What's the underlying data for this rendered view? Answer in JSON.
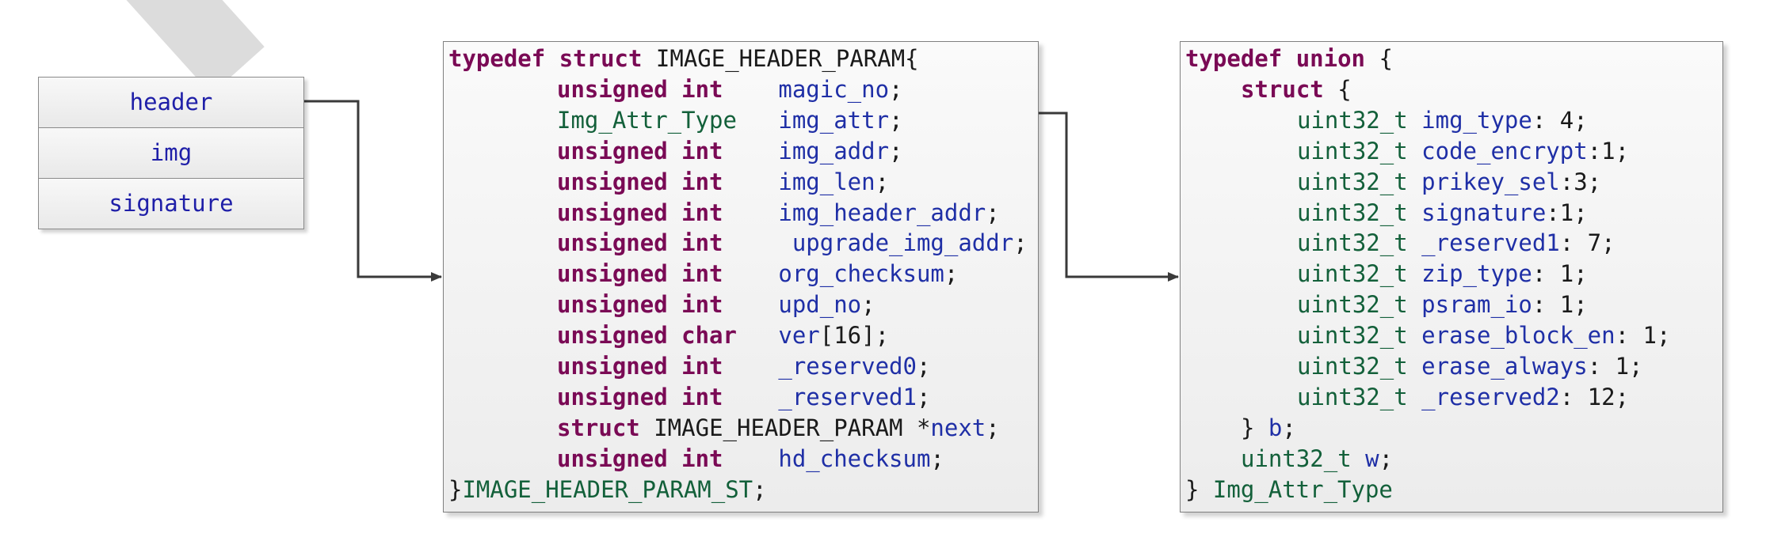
{
  "stack": {
    "items": [
      "header",
      "img",
      "signature"
    ]
  },
  "struct_box": {
    "lines": [
      [
        {
          "t": "kw",
          "s": "typedef"
        },
        {
          "t": "pl",
          "s": " "
        },
        {
          "t": "kw",
          "s": "struct"
        },
        {
          "t": "pl",
          "s": " IMAGE_HEADER_PARAM{"
        }
      ],
      [
        {
          "t": "kw",
          "s": "unsigned int"
        },
        {
          "t": "pl",
          "s": "    "
        },
        {
          "t": "fld",
          "s": "magic_no"
        },
        {
          "t": "pl",
          "s": ";"
        }
      ],
      [
        {
          "t": "ty",
          "s": "Img_Attr_Type"
        },
        {
          "t": "pl",
          "s": "   "
        },
        {
          "t": "fld",
          "s": "img_attr"
        },
        {
          "t": "pl",
          "s": ";"
        }
      ],
      [
        {
          "t": "kw",
          "s": "unsigned int"
        },
        {
          "t": "pl",
          "s": "    "
        },
        {
          "t": "fld",
          "s": "img_addr"
        },
        {
          "t": "pl",
          "s": ";"
        }
      ],
      [
        {
          "t": "kw",
          "s": "unsigned int"
        },
        {
          "t": "pl",
          "s": "    "
        },
        {
          "t": "fld",
          "s": "img_len"
        },
        {
          "t": "pl",
          "s": ";"
        }
      ],
      [
        {
          "t": "kw",
          "s": "unsigned int"
        },
        {
          "t": "pl",
          "s": "    "
        },
        {
          "t": "fld",
          "s": "img_header_addr"
        },
        {
          "t": "pl",
          "s": ";"
        }
      ],
      [
        {
          "t": "kw",
          "s": "unsigned int"
        },
        {
          "t": "pl",
          "s": "     "
        },
        {
          "t": "fld",
          "s": "upgrade_img_addr"
        },
        {
          "t": "pl",
          "s": ";"
        }
      ],
      [
        {
          "t": "kw",
          "s": "unsigned int"
        },
        {
          "t": "pl",
          "s": "    "
        },
        {
          "t": "fld",
          "s": "org_checksum"
        },
        {
          "t": "pl",
          "s": ";"
        }
      ],
      [
        {
          "t": "kw",
          "s": "unsigned int"
        },
        {
          "t": "pl",
          "s": "    "
        },
        {
          "t": "fld",
          "s": "upd_no"
        },
        {
          "t": "pl",
          "s": ";"
        }
      ],
      [
        {
          "t": "kw",
          "s": "unsigned char"
        },
        {
          "t": "pl",
          "s": "   "
        },
        {
          "t": "fld",
          "s": "ver"
        },
        {
          "t": "pl",
          "s": "[16];"
        }
      ],
      [
        {
          "t": "kw",
          "s": "unsigned int"
        },
        {
          "t": "pl",
          "s": "    "
        },
        {
          "t": "fld",
          "s": "_reserved0"
        },
        {
          "t": "pl",
          "s": ";"
        }
      ],
      [
        {
          "t": "kw",
          "s": "unsigned int"
        },
        {
          "t": "pl",
          "s": "    "
        },
        {
          "t": "fld",
          "s": "_reserved1"
        },
        {
          "t": "pl",
          "s": ";"
        }
      ],
      [
        {
          "t": "kw",
          "s": "struct"
        },
        {
          "t": "pl",
          "s": " IMAGE_HEADER_PARAM *"
        },
        {
          "t": "fld",
          "s": "next"
        },
        {
          "t": "pl",
          "s": ";"
        }
      ],
      [
        {
          "t": "kw",
          "s": "unsigned int"
        },
        {
          "t": "pl",
          "s": "    "
        },
        {
          "t": "fld",
          "s": "hd_checksum"
        },
        {
          "t": "pl",
          "s": ";"
        }
      ],
      [
        {
          "t": "pl",
          "s": "}"
        },
        {
          "t": "ty",
          "s": "IMAGE_HEADER_PARAM_ST"
        },
        {
          "t": "pl",
          "s": ";"
        }
      ]
    ]
  },
  "union_box": {
    "lines": [
      [
        {
          "t": "kw",
          "s": "typedef"
        },
        {
          "t": "pl",
          "s": " "
        },
        {
          "t": "kw",
          "s": "union"
        },
        {
          "t": "pl",
          "s": " {"
        }
      ],
      [
        {
          "t": "kw",
          "s": "struct"
        },
        {
          "t": "pl",
          "s": " {"
        }
      ],
      [
        {
          "t": "ty",
          "s": "uint32_t"
        },
        {
          "t": "pl",
          "s": " "
        },
        {
          "t": "fld",
          "s": "img_type"
        },
        {
          "t": "pl",
          "s": ": 4;"
        }
      ],
      [
        {
          "t": "ty",
          "s": "uint32_t"
        },
        {
          "t": "pl",
          "s": " "
        },
        {
          "t": "fld",
          "s": "code_encrypt"
        },
        {
          "t": "pl",
          "s": ":1;"
        }
      ],
      [
        {
          "t": "ty",
          "s": "uint32_t"
        },
        {
          "t": "pl",
          "s": " "
        },
        {
          "t": "fld",
          "s": "prikey_sel"
        },
        {
          "t": "pl",
          "s": ":3;"
        }
      ],
      [
        {
          "t": "ty",
          "s": "uint32_t"
        },
        {
          "t": "pl",
          "s": " "
        },
        {
          "t": "fld",
          "s": "signature"
        },
        {
          "t": "pl",
          "s": ":1;"
        }
      ],
      [
        {
          "t": "ty",
          "s": "uint32_t"
        },
        {
          "t": "pl",
          "s": " "
        },
        {
          "t": "fld",
          "s": "_reserved1"
        },
        {
          "t": "pl",
          "s": ": 7;"
        }
      ],
      [
        {
          "t": "ty",
          "s": "uint32_t"
        },
        {
          "t": "pl",
          "s": " "
        },
        {
          "t": "fld",
          "s": "zip_type"
        },
        {
          "t": "pl",
          "s": ": 1;"
        }
      ],
      [
        {
          "t": "ty",
          "s": "uint32_t"
        },
        {
          "t": "pl",
          "s": " "
        },
        {
          "t": "fld",
          "s": "psram_io"
        },
        {
          "t": "pl",
          "s": ": 1;"
        }
      ],
      [
        {
          "t": "ty",
          "s": "uint32_t"
        },
        {
          "t": "pl",
          "s": " "
        },
        {
          "t": "fld",
          "s": "erase_block_en"
        },
        {
          "t": "pl",
          "s": ": 1;"
        }
      ],
      [
        {
          "t": "ty",
          "s": "uint32_t"
        },
        {
          "t": "pl",
          "s": " "
        },
        {
          "t": "fld",
          "s": "erase_always"
        },
        {
          "t": "pl",
          "s": ": 1;"
        }
      ],
      [
        {
          "t": "ty",
          "s": "uint32_t"
        },
        {
          "t": "pl",
          "s": " "
        },
        {
          "t": "fld",
          "s": "_reserved2"
        },
        {
          "t": "pl",
          "s": ": 12;"
        }
      ],
      [
        {
          "t": "pl",
          "s": "} "
        },
        {
          "t": "fld",
          "s": "b"
        },
        {
          "t": "pl",
          "s": ";"
        }
      ],
      [
        {
          "t": "ty",
          "s": "uint32_t"
        },
        {
          "t": "pl",
          "s": " "
        },
        {
          "t": "fld",
          "s": "w"
        },
        {
          "t": "pl",
          "s": ";"
        }
      ],
      [
        {
          "t": "pl",
          "s": "} "
        },
        {
          "t": "ty",
          "s": "Img_Attr_Type"
        }
      ]
    ]
  },
  "colors": {
    "keyword": "#7a0a55",
    "type": "#13603a",
    "field": "#1f2fa6",
    "connector": "#3a3a3a"
  }
}
